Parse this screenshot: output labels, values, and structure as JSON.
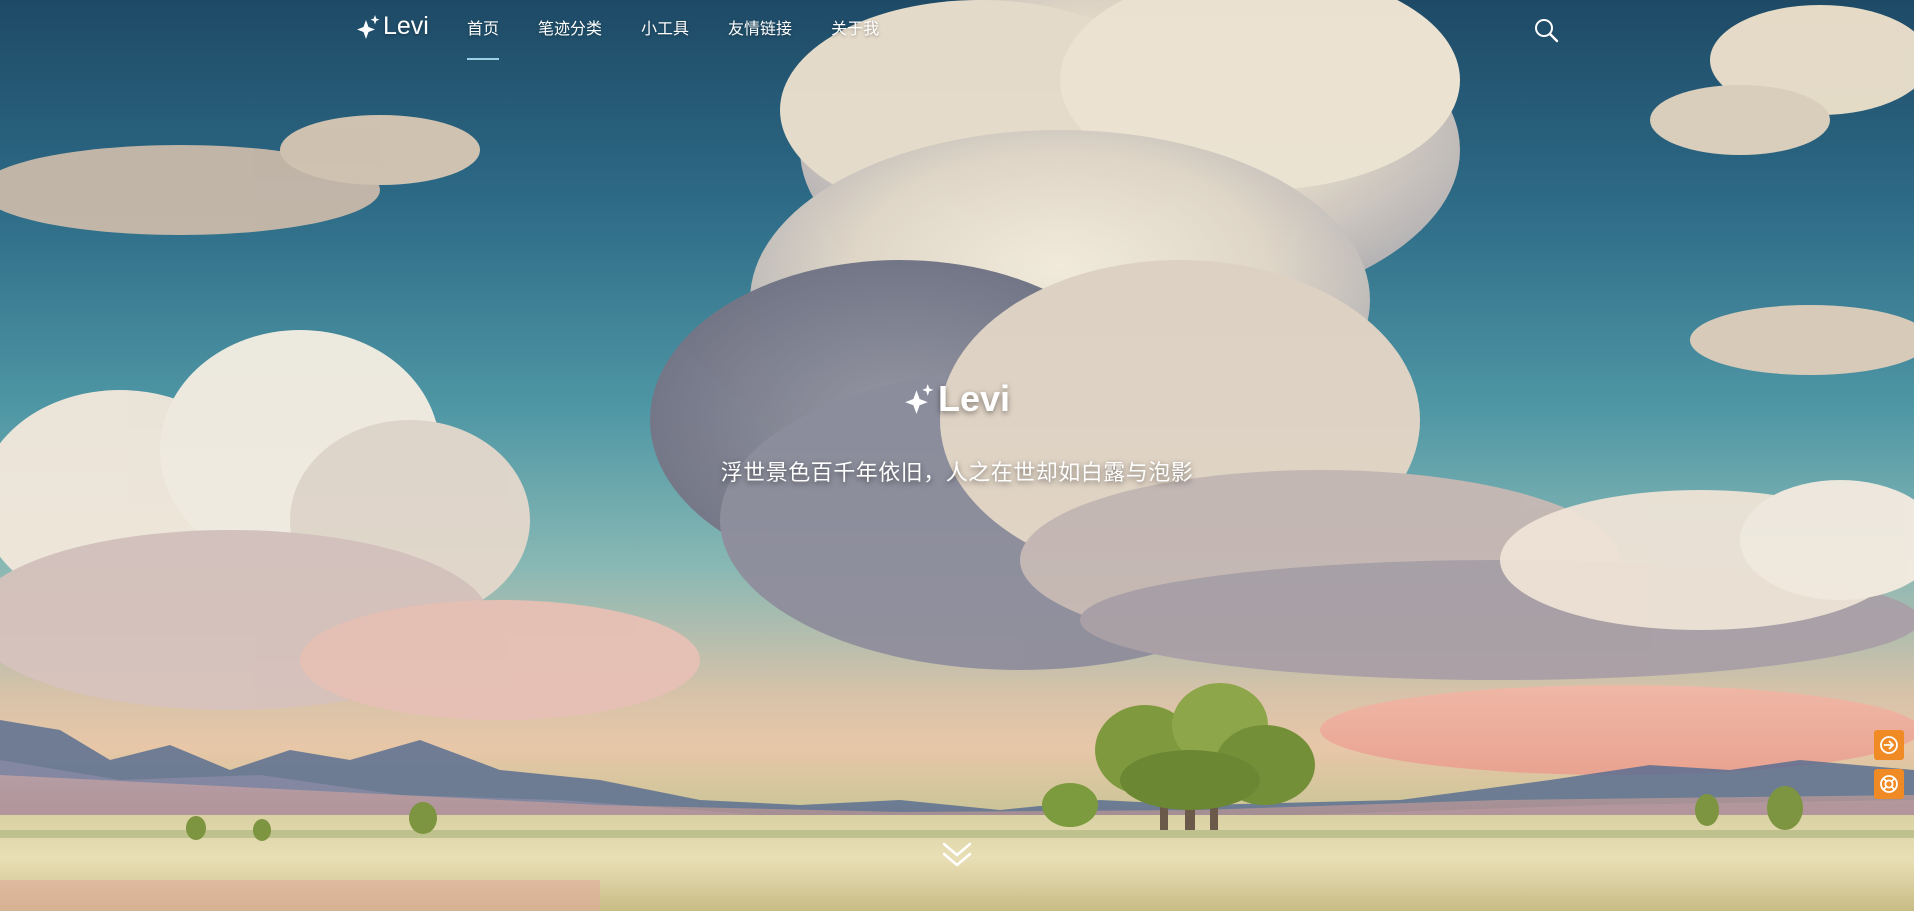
{
  "brand": {
    "name": "Levi",
    "icon": "sparkles-icon"
  },
  "nav": {
    "items": [
      {
        "label": "首页",
        "active": true
      },
      {
        "label": "笔迹分类",
        "active": false
      },
      {
        "label": "小工具",
        "active": false
      },
      {
        "label": "友情链接",
        "active": false
      },
      {
        "label": "关于我",
        "active": false
      }
    ],
    "active_underline_color": "#9ed0e6"
  },
  "search": {
    "icon": "search-icon"
  },
  "hero": {
    "title": "Levi",
    "title_icon": "sparkles-icon",
    "subtitle": "浮世景色百千年依旧，人之在世却如白露与泡影",
    "background": "painted-sky-clouds-meadow-illustration"
  },
  "scroll": {
    "icon": "double-chevron-down-icon"
  },
  "side_actions": [
    {
      "icon": "arrow-right-circle-icon",
      "color": "#f08a24"
    },
    {
      "icon": "lifebuoy-icon",
      "color": "#f08a24"
    }
  ]
}
